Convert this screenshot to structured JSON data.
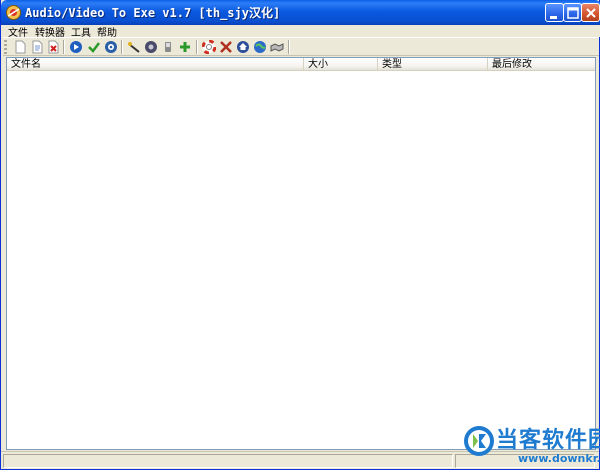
{
  "window": {
    "title": "Audio/Video To Exe v1.7 [th_sjy汉化]"
  },
  "menu": {
    "items": [
      {
        "label": "文件"
      },
      {
        "label": "转换器"
      },
      {
        "label": "工具"
      },
      {
        "label": "帮助"
      }
    ]
  },
  "toolbar": {
    "icons": [
      "new-file-icon",
      "open-file-icon",
      "delete-file-icon",
      "play-icon",
      "check-icon",
      "settings-disc-icon",
      "magic-wand-icon",
      "music-disc-icon",
      "device-icon",
      "plus-icon",
      "help-lifebuoy-icon",
      "tools-icon",
      "home-globe-icon",
      "web-globe-icon",
      "handshake-icon"
    ]
  },
  "list": {
    "columns": [
      {
        "label": "文件名"
      },
      {
        "label": "大小"
      },
      {
        "label": "类型"
      },
      {
        "label": "最后修改"
      }
    ],
    "rows": []
  },
  "watermark": {
    "text": "当客软件园",
    "url": "www.downkr.com"
  }
}
